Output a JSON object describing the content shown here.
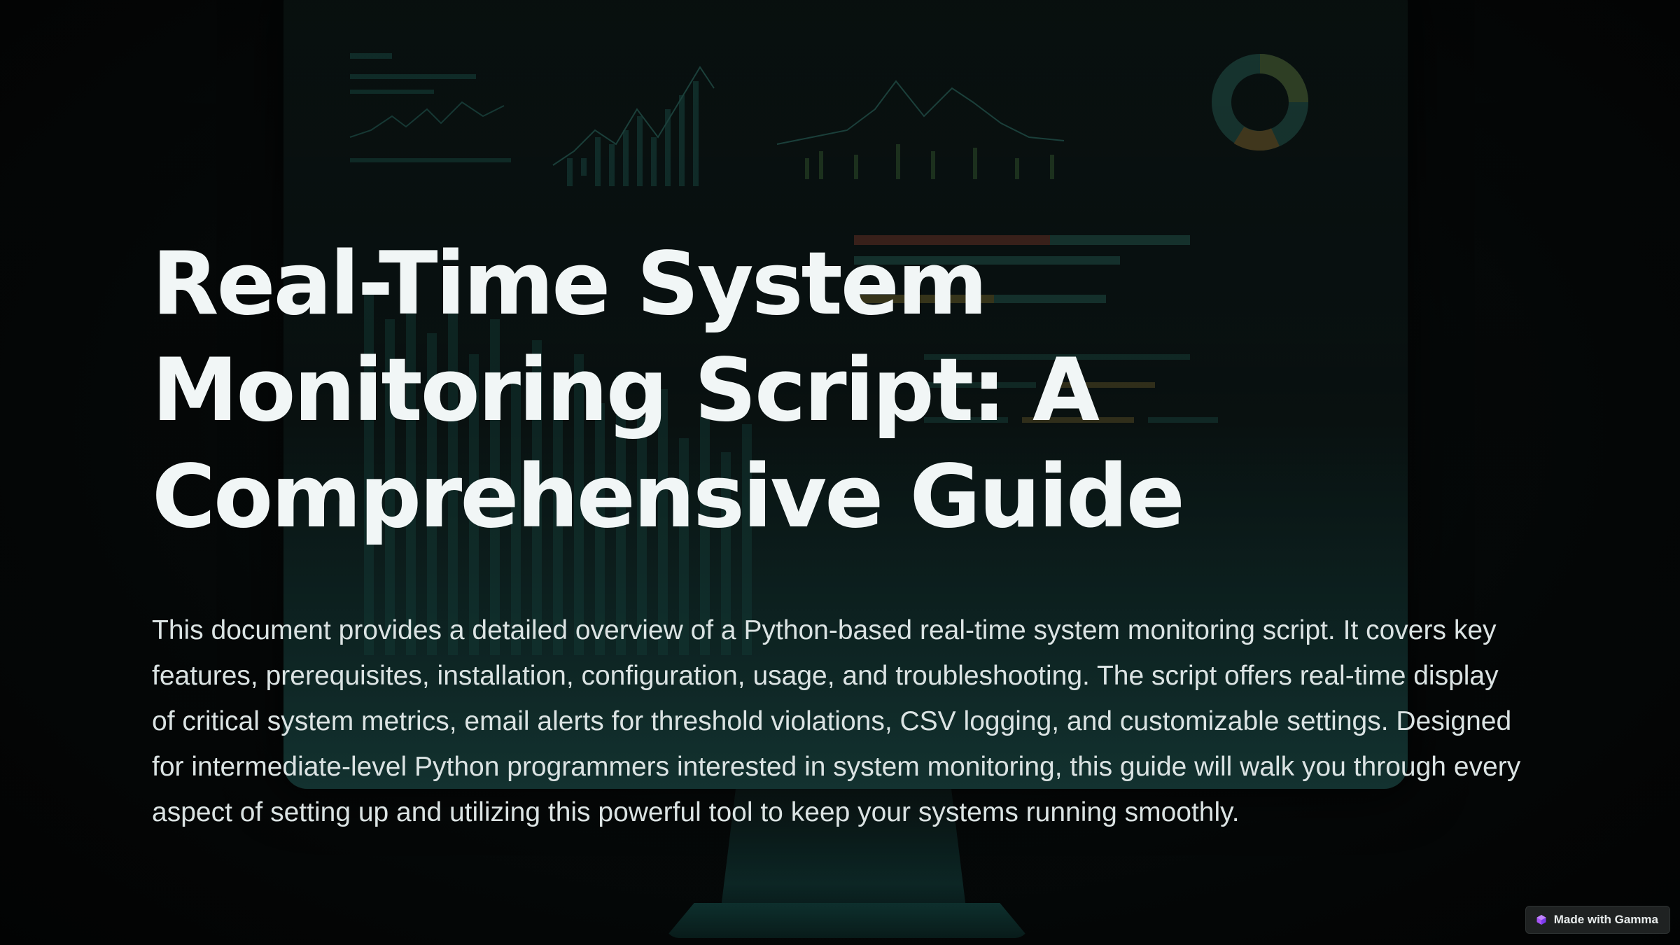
{
  "slide": {
    "title": "Real-Time System Monitoring Script: A Comprehensive Guide",
    "description": "This document provides a detailed overview of a Python-based real-time system monitoring script. It covers key features, prerequisites, installation, configuration, usage, and troubleshooting. The script offers real-time display of critical system metrics, email alerts for threshold violations, CSV logging, and customizable settings. Designed for intermediate-level Python programmers interested in system monitoring, this guide will walk you through every aspect of setting up and utilizing this powerful tool to keep your systems running smoothly."
  },
  "badge": {
    "label": "Made with Gamma",
    "icon": "gamma-logo-icon"
  },
  "colors": {
    "background": "#050707",
    "title_text": "#f1f6f6",
    "body_text": "#dbe3e3",
    "monitor_teal": "#1a4542",
    "badge_background": "#1f2222",
    "badge_icon": "#a855f7"
  }
}
